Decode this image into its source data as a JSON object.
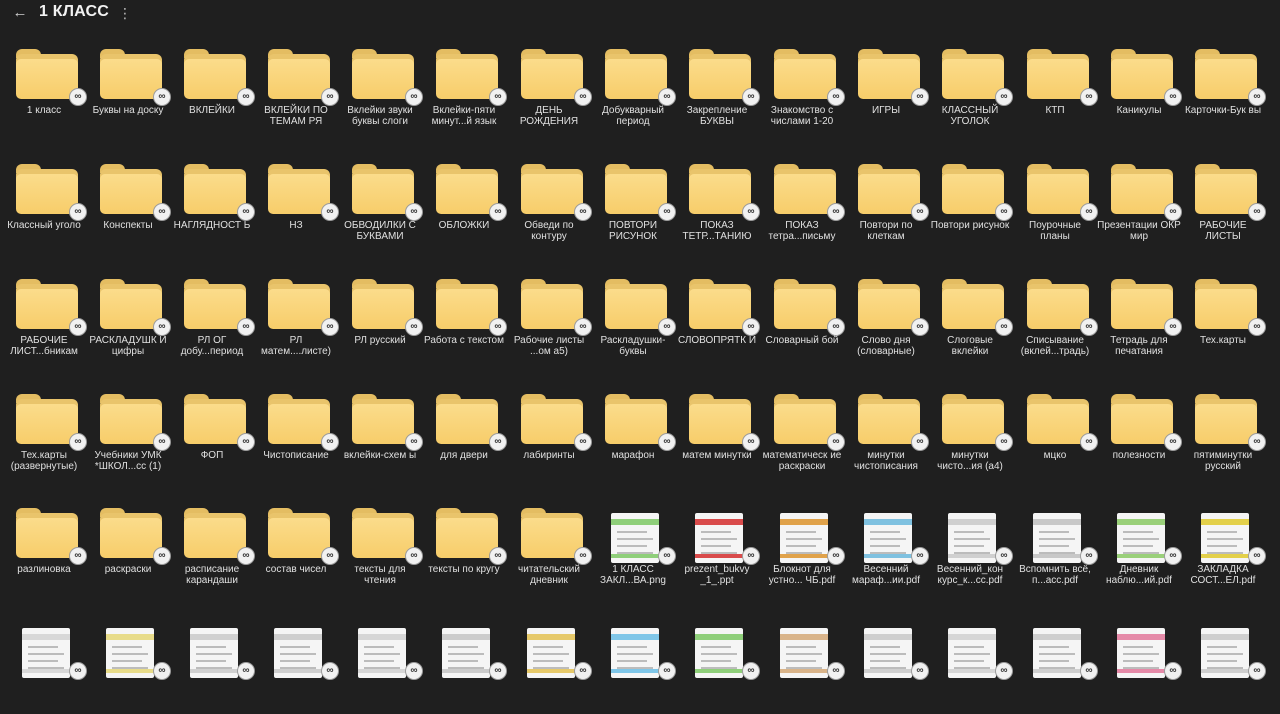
{
  "header": {
    "back_icon": "arrow-left-icon",
    "title": "1 КЛАСС",
    "menu_icon": "more-vertical-icon"
  },
  "items": [
    {
      "type": "folder",
      "name": "1 класс"
    },
    {
      "type": "folder",
      "name": "Буквы на доску"
    },
    {
      "type": "folder",
      "name": "ВКЛЕЙКИ"
    },
    {
      "type": "folder",
      "name": "ВКЛЕЙКИ ПО ТЕМАМ РЯ"
    },
    {
      "type": "folder",
      "name": "Вклейки звуки буквы слоги"
    },
    {
      "type": "folder",
      "name": "Вклейки-пяти минут...й язык"
    },
    {
      "type": "folder",
      "name": "ДЕНЬ РОЖДЕНИЯ"
    },
    {
      "type": "folder",
      "name": "Добукварный период"
    },
    {
      "type": "folder",
      "name": "Закрепление БУКВЫ"
    },
    {
      "type": "folder",
      "name": "Знакомство с числами 1-20"
    },
    {
      "type": "folder",
      "name": "ИГРЫ"
    },
    {
      "type": "folder",
      "name": "КЛАССНЫЙ УГОЛОК"
    },
    {
      "type": "folder",
      "name": "КТП"
    },
    {
      "type": "folder",
      "name": "Каникулы"
    },
    {
      "type": "folder",
      "name": "Карточки-Бук вы"
    },
    {
      "type": "folder",
      "name": "Классный уголо"
    },
    {
      "type": "folder",
      "name": "Конспекты"
    },
    {
      "type": "folder",
      "name": "НАГЛЯДНОСТ Ь"
    },
    {
      "type": "folder",
      "name": "НЗ"
    },
    {
      "type": "folder",
      "name": "ОБВОДИЛКИ С БУКВАМИ"
    },
    {
      "type": "folder",
      "name": "ОБЛОЖКИ"
    },
    {
      "type": "folder",
      "name": "Обведи по контуру"
    },
    {
      "type": "folder",
      "name": "ПОВТОРИ РИСУНОК"
    },
    {
      "type": "folder",
      "name": "ПОКАЗ ТЕТР...ТАНИЮ"
    },
    {
      "type": "folder",
      "name": "ПОКАЗ тетра...письму"
    },
    {
      "type": "folder",
      "name": "Повтори по клеткам"
    },
    {
      "type": "folder",
      "name": "Повтори рисунок"
    },
    {
      "type": "folder",
      "name": "Поурочные планы"
    },
    {
      "type": "folder",
      "name": "Презентации ОКР мир"
    },
    {
      "type": "folder",
      "name": "РАБОЧИЕ ЛИСТЫ"
    },
    {
      "type": "folder",
      "name": "РАБОЧИЕ ЛИСТ...бникам"
    },
    {
      "type": "folder",
      "name": "РАСКЛАДУШК И цифры"
    },
    {
      "type": "folder",
      "name": "РЛ ОГ добу...период"
    },
    {
      "type": "folder",
      "name": "РЛ матем....листе)"
    },
    {
      "type": "folder",
      "name": "РЛ русский"
    },
    {
      "type": "folder",
      "name": "Работа с текстом"
    },
    {
      "type": "folder",
      "name": "Рабочие листы ...ом а5)"
    },
    {
      "type": "folder",
      "name": "Раскладушки-буквы"
    },
    {
      "type": "folder",
      "name": "СЛОВОПРЯТК И"
    },
    {
      "type": "folder",
      "name": "Словарный бой"
    },
    {
      "type": "folder",
      "name": "Слово дня (словарные)"
    },
    {
      "type": "folder",
      "name": "Слоговые вклейки"
    },
    {
      "type": "folder",
      "name": "Списывание (вклей...традь)"
    },
    {
      "type": "folder",
      "name": "Тетрадь для печатания"
    },
    {
      "type": "folder",
      "name": "Тех.карты"
    },
    {
      "type": "folder",
      "name": "Тех.карты (развернутые)"
    },
    {
      "type": "folder",
      "name": "Учебники УМК *ШКОЛ...сс (1)"
    },
    {
      "type": "folder",
      "name": "ФОП"
    },
    {
      "type": "folder",
      "name": "Чистописание"
    },
    {
      "type": "folder",
      "name": "вклейки-схем ы"
    },
    {
      "type": "folder",
      "name": "для двери"
    },
    {
      "type": "folder",
      "name": "лабиринты"
    },
    {
      "type": "folder",
      "name": "марафон"
    },
    {
      "type": "folder",
      "name": "матем минутки"
    },
    {
      "type": "folder",
      "name": "математическ ие раскраски"
    },
    {
      "type": "folder",
      "name": "минутки чистописания"
    },
    {
      "type": "folder",
      "name": "минутки чисто...ия (а4)"
    },
    {
      "type": "folder",
      "name": "мцко"
    },
    {
      "type": "folder",
      "name": "полезности"
    },
    {
      "type": "folder",
      "name": "пятиминутки русский"
    },
    {
      "type": "folder",
      "name": "разлиновка"
    },
    {
      "type": "folder",
      "name": "раскраски"
    },
    {
      "type": "folder",
      "name": "расписание карандаши"
    },
    {
      "type": "folder",
      "name": "состав чисел"
    },
    {
      "type": "folder",
      "name": "тексты для чтения"
    },
    {
      "type": "folder",
      "name": "тексты по кругу"
    },
    {
      "type": "folder",
      "name": "читательский дневник"
    },
    {
      "type": "file",
      "name": "1 КЛАСС ЗАКЛ...ВА.png",
      "accent": "#8fcf7a"
    },
    {
      "type": "file",
      "name": "prezent_bukvy _1_.ppt",
      "accent": "#d94b4b"
    },
    {
      "type": "file",
      "name": "Блокнот для устно... ЧБ.pdf",
      "accent": "#e0a24a"
    },
    {
      "type": "file",
      "name": "Весенний мараф...ии.pdf",
      "accent": "#7fc1e0"
    },
    {
      "type": "file",
      "name": "Весенний_кон курс_к...сс.pdf",
      "accent": "#d0d0d0"
    },
    {
      "type": "file",
      "name": "Вспомнить всё, п...асс.pdf",
      "accent": "#c8c8c8"
    },
    {
      "type": "file",
      "name": "Дневник наблю...ий.pdf",
      "accent": "#9ad07a"
    },
    {
      "type": "file",
      "name": "ЗАКЛАДКА СОСТ...ЕЛ.pdf",
      "accent": "#e3d04a"
    },
    {
      "type": "file",
      "name": "",
      "accent": "#d8d8d8"
    },
    {
      "type": "file",
      "name": "",
      "accent": "#e8dc8a"
    },
    {
      "type": "file",
      "name": "",
      "accent": "#d0d0d0"
    },
    {
      "type": "file",
      "name": "",
      "accent": "#cfcfcf"
    },
    {
      "type": "file",
      "name": "",
      "accent": "#d6d6d6"
    },
    {
      "type": "file",
      "name": "",
      "accent": "#cccccc"
    },
    {
      "type": "file",
      "name": "",
      "accent": "#e6c96a"
    },
    {
      "type": "file",
      "name": "",
      "accent": "#7fc6e8"
    },
    {
      "type": "file",
      "name": "",
      "accent": "#8fcf7a"
    },
    {
      "type": "file",
      "name": "",
      "accent": "#d9b48a"
    },
    {
      "type": "file",
      "name": "",
      "accent": "#cfcfcf"
    },
    {
      "type": "file",
      "name": "",
      "accent": "#d6d6d6"
    },
    {
      "type": "file",
      "name": "",
      "accent": "#cfcfcf"
    },
    {
      "type": "file",
      "name": "",
      "accent": "#e58aa8"
    },
    {
      "type": "file",
      "name": "",
      "accent": "#cfcfcf"
    }
  ]
}
